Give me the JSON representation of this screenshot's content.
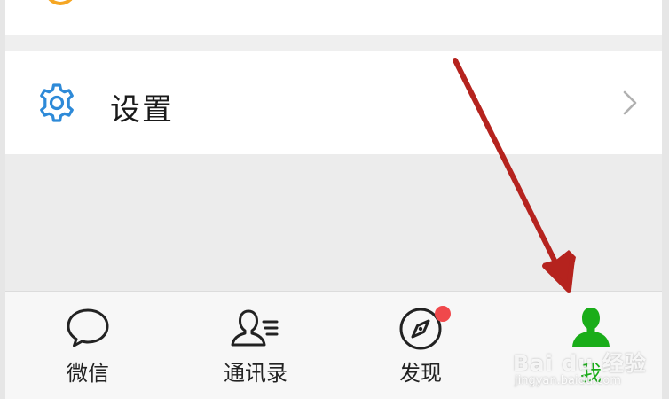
{
  "settings": {
    "label": "设置",
    "icon": "gear-icon",
    "chevron_icon": "chevron-right-icon"
  },
  "tabbar": {
    "tabs": [
      {
        "label": "微信",
        "icon": "chat-bubble-icon",
        "active": false
      },
      {
        "label": "通讯录",
        "icon": "contacts-icon",
        "active": false
      },
      {
        "label": "发现",
        "icon": "compass-icon",
        "active": false,
        "badge": true
      },
      {
        "label": "我",
        "icon": "person-icon",
        "active": true
      }
    ]
  },
  "watermark": {
    "main": "Bai du 经验",
    "sub": "jingyan.baidu.com"
  },
  "colors": {
    "accent_green": "#1aad19",
    "gear_blue": "#2e8ad8",
    "badge_red": "#f0484b",
    "arrow_red": "#b5231e",
    "top_icon_orange": "#f5a623"
  }
}
